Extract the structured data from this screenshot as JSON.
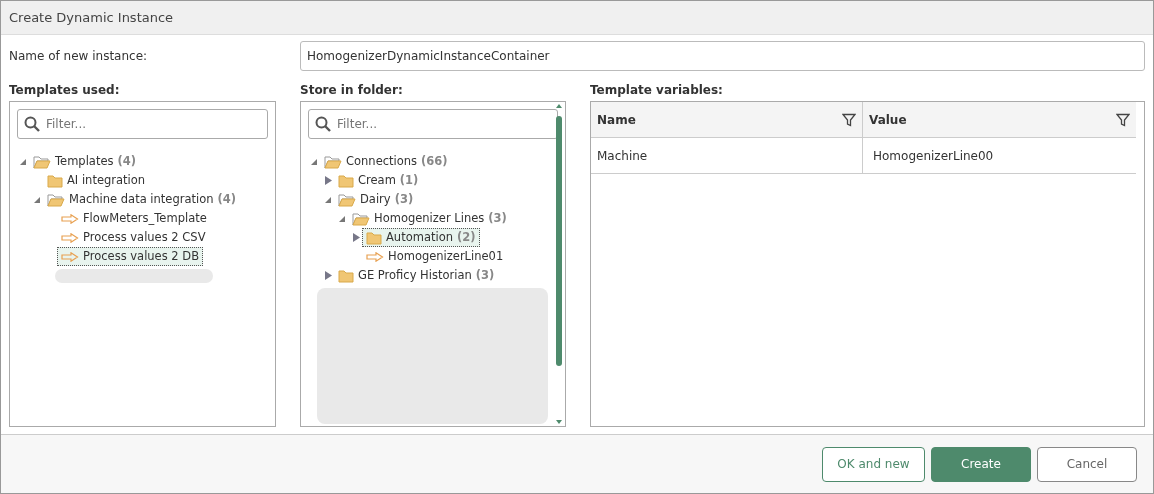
{
  "window": {
    "title": "Create Dynamic Instance"
  },
  "name_field": {
    "label": "Name of new instance:",
    "value": "HomogenizerDynamicInstanceContainer"
  },
  "templates_panel": {
    "heading": "Templates used:",
    "filter_placeholder": "Filter...",
    "tree": [
      {
        "label": "Templates",
        "count": "(4)",
        "kind": "folder",
        "expandable": true,
        "expanded": true,
        "selected": false,
        "children": [
          {
            "label": "AI integration",
            "kind": "folder",
            "expandable": false,
            "expanded": false,
            "selected": false
          },
          {
            "label": "Machine data integration",
            "count": "(4)",
            "kind": "folder",
            "expandable": true,
            "expanded": true,
            "selected": false,
            "children": [
              {
                "label": "FlowMeters_Template",
                "kind": "template",
                "expandable": false,
                "expanded": false,
                "selected": false
              },
              {
                "label": "Process values 2 CSV",
                "kind": "template",
                "expandable": false,
                "expanded": false,
                "selected": false
              },
              {
                "label": "Process values 2 DB",
                "kind": "template",
                "expandable": false,
                "expanded": false,
                "selected": true
              }
            ]
          }
        ]
      }
    ]
  },
  "folder_panel": {
    "heading": "Store in folder:",
    "filter_placeholder": "Filter...",
    "tree": [
      {
        "label": "Connections",
        "count": "(66)",
        "kind": "folder",
        "expandable": true,
        "expanded": true,
        "selected": false,
        "children": [
          {
            "label": "Cream",
            "count": "(1)",
            "kind": "folder",
            "expandable": true,
            "expanded": false,
            "selected": false
          },
          {
            "label": "Dairy",
            "count": "(3)",
            "kind": "folder",
            "expandable": true,
            "expanded": true,
            "selected": false,
            "children": [
              {
                "label": "Homogenizer Lines",
                "count": "(3)",
                "kind": "folder",
                "expandable": true,
                "expanded": true,
                "selected": false,
                "children": [
                  {
                    "label": "Automation",
                    "count": "(2)",
                    "kind": "folder",
                    "expandable": true,
                    "expanded": false,
                    "selected": true
                  },
                  {
                    "label": "HomogenizerLine01",
                    "kind": "template",
                    "expandable": false,
                    "expanded": false,
                    "selected": false
                  }
                ]
              }
            ]
          },
          {
            "label": "GE Proficy Historian",
            "count": "(3)",
            "kind": "folder",
            "expandable": true,
            "expanded": false,
            "selected": false
          }
        ]
      }
    ]
  },
  "variables_panel": {
    "heading": "Template variables:",
    "columns": [
      "Name",
      "Value"
    ],
    "rows": [
      [
        "Machine",
        "HomogenizerLine00"
      ]
    ]
  },
  "buttons": [
    {
      "label": "OK and new",
      "kind": "secondary"
    },
    {
      "label": "Create",
      "kind": "primary"
    },
    {
      "label": "Cancel",
      "kind": "plain"
    }
  ]
}
